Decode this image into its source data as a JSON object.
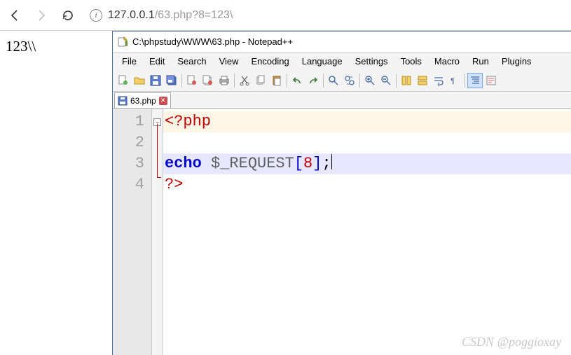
{
  "browser": {
    "url_host": "127.0.0.1",
    "url_path": "/63.php?8=123\\",
    "page_output": "123\\\\"
  },
  "notepadpp": {
    "title": "C:\\phpstudy\\WWW\\63.php - Notepad++",
    "menu": [
      "File",
      "Edit",
      "Search",
      "View",
      "Encoding",
      "Language",
      "Settings",
      "Tools",
      "Macro",
      "Run",
      "Plugins"
    ],
    "tab": {
      "filename": "63.php"
    },
    "code": {
      "lines": [
        {
          "n": 1,
          "tokens": [
            [
              "tag",
              "<?php"
            ]
          ]
        },
        {
          "n": 2,
          "tokens": []
        },
        {
          "n": 3,
          "tokens": [
            [
              "kw",
              "echo"
            ],
            [
              "plain",
              " "
            ],
            [
              "var",
              "$_REQUEST"
            ],
            [
              "br",
              "["
            ],
            [
              "num",
              "8"
            ],
            [
              "br",
              "]"
            ],
            [
              "punc",
              ";"
            ]
          ]
        },
        {
          "n": 4,
          "tokens": [
            [
              "tag",
              "?>"
            ]
          ]
        }
      ],
      "current_line": 3
    }
  },
  "watermark": "CSDN @poggioxay"
}
